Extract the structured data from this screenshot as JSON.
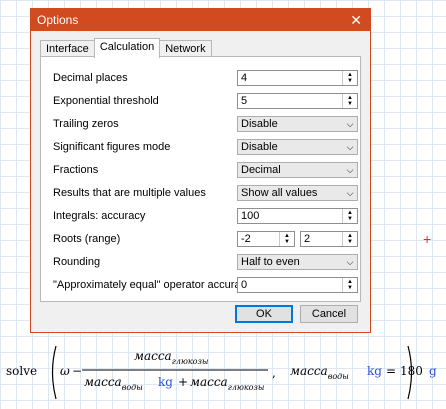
{
  "dialog": {
    "title": "Options",
    "close_glyph": "✕",
    "tabs": [
      "Interface",
      "Calculation",
      "Network"
    ],
    "active_tab": "Calculation",
    "rows": [
      {
        "label": "Decimal places",
        "type": "spinner",
        "value": "4"
      },
      {
        "label": "Exponential threshold",
        "type": "spinner",
        "value": "5"
      },
      {
        "label": "Trailing zeros",
        "type": "select",
        "value": "Disable"
      },
      {
        "label": "Significant figures mode",
        "type": "select",
        "value": "Disable"
      },
      {
        "label": "Fractions",
        "type": "select",
        "value": "Decimal"
      },
      {
        "label": "Results that are multiple values",
        "type": "select",
        "value": "Show all values"
      },
      {
        "label": "Integrals: accuracy",
        "type": "spinner",
        "value": "100"
      },
      {
        "label": "Roots (range)",
        "type": "range",
        "value": "-2",
        "value2": "2"
      },
      {
        "label": "Rounding",
        "type": "select",
        "value": "Half to even"
      },
      {
        "label": "\"Approximately equal\" operator accuracy",
        "type": "spinner",
        "value": "0"
      }
    ],
    "ok_label": "OK",
    "cancel_label": "Cancel"
  },
  "worksheet": {
    "cursor_glyph": "+",
    "formula": {
      "func": "solve",
      "omega": "ω",
      "minus": "−",
      "numerator_var": "масса",
      "numerator_sub": "глюкозы",
      "denominator_var1": "масса",
      "denominator_sub1": "воды",
      "unit1": "kg",
      "plus": "+",
      "denominator_var2": "масса",
      "denominator_sub2": "глюкозы",
      "comma": ",",
      "solve_var": "масса",
      "solve_sub": "воды",
      "unit2": "kg",
      "equals": "=",
      "result": "180",
      "result_unit": "g"
    }
  }
}
